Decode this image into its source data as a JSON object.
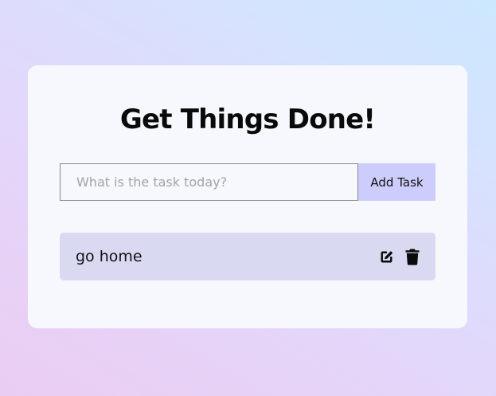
{
  "app": {
    "title": "Get Things Done!"
  },
  "form": {
    "input_value": "",
    "input_placeholder": "What is the task today?",
    "submit_label": "Add Task"
  },
  "todos": [
    {
      "text": "go home",
      "edit_icon": "edit-icon",
      "delete_icon": "trash-icon"
    }
  ],
  "colors": {
    "card_background": "#f6f8fe",
    "add_button": "#cdcdfd",
    "todo_item": "#d9d9f2"
  }
}
